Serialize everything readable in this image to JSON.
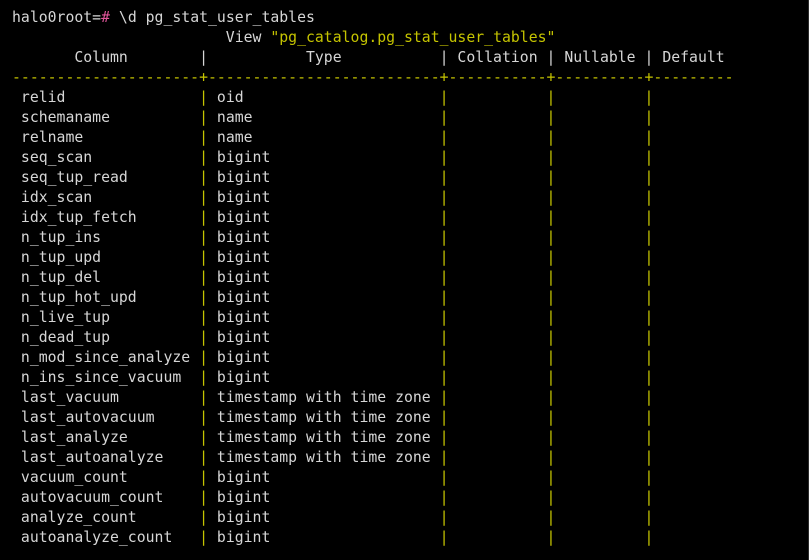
{
  "prompt": {
    "user_host": "halo0root=",
    "symbol": "#",
    "command": " \\d pg_stat_user_tables"
  },
  "title": {
    "prefix": "                        View ",
    "name": "\"pg_catalog.pg_stat_user_tables\""
  },
  "header": {
    "text": "       Column        |           Type           | Collation | Nullable | Default"
  },
  "separator": "---------------------+--------------------------+-----------+----------+---------",
  "columns": [
    {
      "name": "relid",
      "type": "oid"
    },
    {
      "name": "schemaname",
      "type": "name"
    },
    {
      "name": "relname",
      "type": "name"
    },
    {
      "name": "seq_scan",
      "type": "bigint"
    },
    {
      "name": "seq_tup_read",
      "type": "bigint"
    },
    {
      "name": "idx_scan",
      "type": "bigint"
    },
    {
      "name": "idx_tup_fetch",
      "type": "bigint"
    },
    {
      "name": "n_tup_ins",
      "type": "bigint"
    },
    {
      "name": "n_tup_upd",
      "type": "bigint"
    },
    {
      "name": "n_tup_del",
      "type": "bigint"
    },
    {
      "name": "n_tup_hot_upd",
      "type": "bigint"
    },
    {
      "name": "n_live_tup",
      "type": "bigint"
    },
    {
      "name": "n_dead_tup",
      "type": "bigint"
    },
    {
      "name": "n_mod_since_analyze",
      "type": "bigint"
    },
    {
      "name": "n_ins_since_vacuum",
      "type": "bigint"
    },
    {
      "name": "last_vacuum",
      "type": "timestamp with time zone"
    },
    {
      "name": "last_autovacuum",
      "type": "timestamp with time zone"
    },
    {
      "name": "last_analyze",
      "type": "timestamp with time zone"
    },
    {
      "name": "last_autoanalyze",
      "type": "timestamp with time zone"
    },
    {
      "name": "vacuum_count",
      "type": "bigint"
    },
    {
      "name": "autovacuum_count",
      "type": "bigint"
    },
    {
      "name": "analyze_count",
      "type": "bigint"
    },
    {
      "name": "autoanalyze_count",
      "type": "bigint"
    }
  ],
  "colors": {
    "background": "#000000",
    "text": "#d6d6d6",
    "separator": "#c5c400",
    "title_name": "#c5c400",
    "prompt_symbol": "#e0559a"
  }
}
